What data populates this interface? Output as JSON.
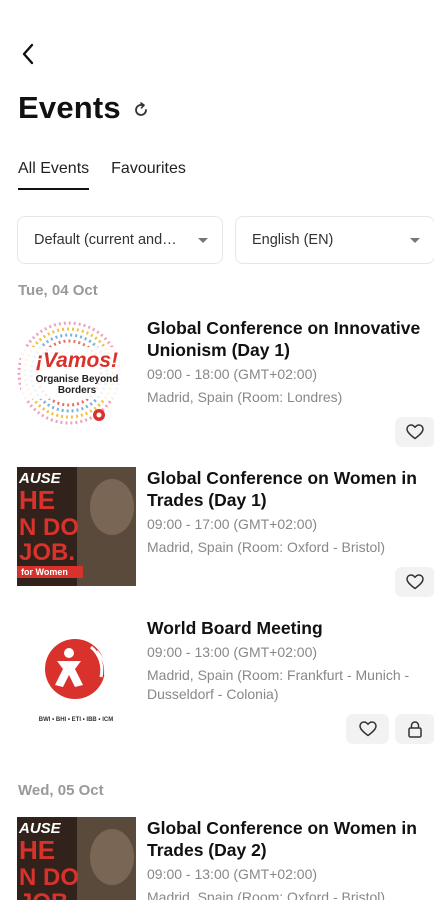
{
  "header": {
    "title": "Events"
  },
  "tabs": [
    {
      "label": "All Events"
    },
    {
      "label": "Favourites"
    }
  ],
  "filters": {
    "sort": "Default (current and…",
    "language": "English (EN)"
  },
  "days": [
    {
      "date": "Tue, 04 Oct"
    },
    {
      "date": "Wed, 05 Oct"
    }
  ],
  "events": [
    {
      "title": "Global Conference on Innovative Unionism (Day 1)",
      "time": "09:00 - 18:00 (GMT+02:00)",
      "location": "Madrid, Spain (Room: Londres)",
      "logo_text": "¡Vamos!",
      "logo_sub": "Organise Beyond Borders"
    },
    {
      "title": "Global Conference on Women in Trades (Day 1)",
      "time": "09:00 - 17:00 (GMT+02:00)",
      "location": "Madrid, Spain (Room: Oxford - Bristol)",
      "poster_lines": [
        "AUSE",
        "HE",
        "N DO",
        "JOB.",
        "for Women"
      ]
    },
    {
      "title": "World Board Meeting",
      "time": "09:00 - 13:00 (GMT+02:00)",
      "location": "Madrid, Spain (Room: Frankfurt - Munich - Dusseldorf - Colonia)",
      "logo_caption": "BWI • BHI • ETI • IBB • ICM"
    },
    {
      "title": "Global Conference on Women in Trades (Day 2)",
      "time": "09:00 - 13:00 (GMT+02:00)",
      "location": "Madrid, Spain (Room: Oxford - Bristol)",
      "poster_lines": [
        "AUSE",
        "HE",
        "N DO",
        "JOB."
      ]
    }
  ],
  "colors": {
    "brand_red": "#d9312b",
    "muted": "#888888"
  }
}
